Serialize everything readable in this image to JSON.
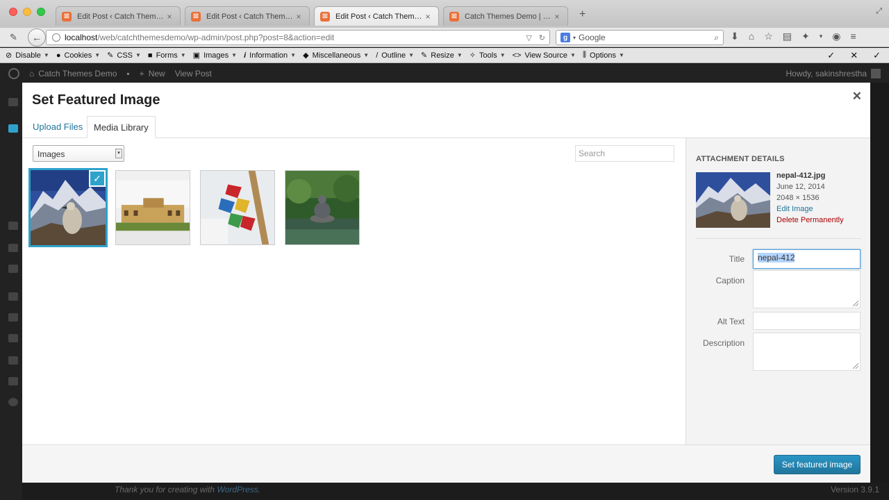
{
  "browser": {
    "tabs": [
      {
        "title": "Edit Post ‹ Catch Themes ...",
        "active": false
      },
      {
        "title": "Edit Post ‹ Catch Themes ...",
        "active": false
      },
      {
        "title": "Edit Post ‹ Catch Themes ...",
        "active": true
      },
      {
        "title": "Catch Themes Demo | Jus...",
        "active": false
      }
    ],
    "url_host": "localhost",
    "url_path": "/web/catchthemesdemo/wp-admin/post.php?post=8&action=edit",
    "search_engine": "Google",
    "search_placeholder": "Google"
  },
  "dev_toolbar": {
    "items": [
      {
        "label": "Disable",
        "icon": "no-icon"
      },
      {
        "label": "Cookies",
        "icon": "user-icon"
      },
      {
        "label": "CSS",
        "icon": "pencil-icon"
      },
      {
        "label": "Forms",
        "icon": "briefcase-icon"
      },
      {
        "label": "Images",
        "icon": "picture-icon"
      },
      {
        "label": "Information",
        "icon": "info-icon"
      },
      {
        "label": "Miscellaneous",
        "icon": "cube-icon"
      },
      {
        "label": "Outline",
        "icon": "outline-pencil-icon"
      },
      {
        "label": "Resize",
        "icon": "resize-icon"
      },
      {
        "label": "Tools",
        "icon": "wrench-icon"
      },
      {
        "label": "View Source",
        "icon": "code-icon"
      },
      {
        "label": "Options",
        "icon": "sliders-icon"
      }
    ]
  },
  "wp_adminbar": {
    "site_name": "Catch Themes Demo",
    "new_label": "New",
    "view_post": "View Post",
    "howdy": "Howdy, sakinshrestha"
  },
  "wp_footer": {
    "thanks_prefix": "Thank you for creating with",
    "thanks_link": "WordPress",
    "thanks_suffix": ".",
    "version": "Version 3.9.1"
  },
  "modal": {
    "title": "Set Featured Image",
    "tabs": {
      "upload": "Upload Files",
      "library": "Media Library"
    },
    "filter_selected": "Images",
    "search_placeholder": "Search",
    "attachments": [
      {
        "name": "nepal-412",
        "selected": true
      },
      {
        "name": "building",
        "selected": false
      },
      {
        "name": "prayer-flags",
        "selected": false
      },
      {
        "name": "buddha-statue",
        "selected": false
      }
    ],
    "details": {
      "heading": "ATTACHMENT DETAILS",
      "filename": "nepal-412.jpg",
      "date": "June 12, 2014",
      "dimensions": "2048 × 1536",
      "edit_link": "Edit Image",
      "delete_link": "Delete Permanently",
      "fields": {
        "title_label": "Title",
        "title_value": "nepal-412",
        "caption_label": "Caption",
        "caption_value": "",
        "alt_label": "Alt Text",
        "alt_value": "",
        "description_label": "Description",
        "description_value": ""
      }
    },
    "primary_button": "Set featured image"
  },
  "colors": {
    "wp_blue": "#2ea2cc",
    "button_blue": "#21759b",
    "delete_red": "#aa0000"
  }
}
